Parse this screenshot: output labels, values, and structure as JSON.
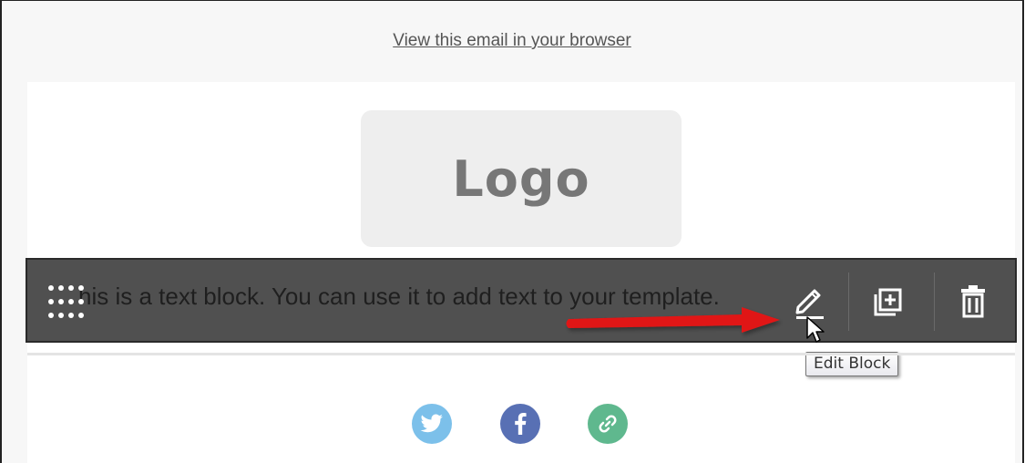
{
  "header": {
    "view_in_browser": "View this email in your browser"
  },
  "logo": {
    "text": "Logo"
  },
  "text_block": {
    "text": "his is a text block. You can use it to add text to your template.",
    "toolbar": {
      "edit_icon": "pencil-icon",
      "duplicate_icon": "duplicate-icon",
      "delete_icon": "trash-icon",
      "drag_icon": "drag-handle-icon"
    }
  },
  "tooltip": {
    "text": "Edit Block"
  },
  "social": {
    "icons": [
      "twitter-icon",
      "facebook-icon",
      "link-icon"
    ],
    "colors": {
      "twitter": "#7cc0ea",
      "facebook": "#5870b4",
      "link": "#5fb88e"
    }
  },
  "colors": {
    "toolbar_bg": "#505050",
    "arrow": "#e01515",
    "logo_bg": "#eeeeee"
  }
}
